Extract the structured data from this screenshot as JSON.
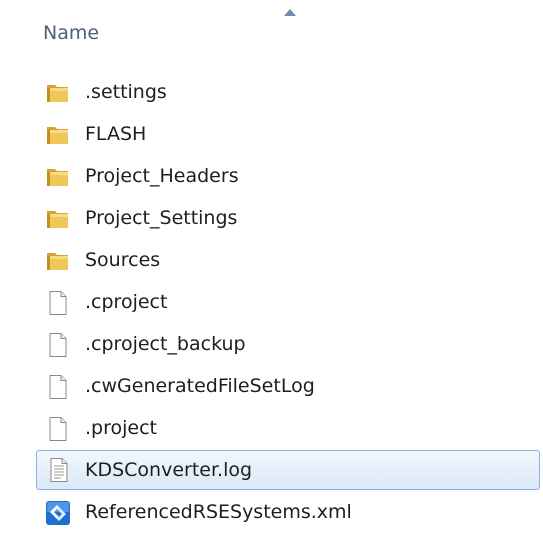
{
  "header": {
    "name_label": "Name"
  },
  "items": [
    {
      "name": ".settings",
      "type": "folder",
      "icon": "folder-icon"
    },
    {
      "name": "FLASH",
      "type": "folder",
      "icon": "folder-icon"
    },
    {
      "name": "Project_Headers",
      "type": "folder",
      "icon": "folder-icon"
    },
    {
      "name": "Project_Settings",
      "type": "folder",
      "icon": "folder-icon"
    },
    {
      "name": "Sources",
      "type": "folder",
      "icon": "folder-icon"
    },
    {
      "name": ".cproject",
      "type": "file",
      "icon": "blank-file-icon"
    },
    {
      "name": ".cproject_backup",
      "type": "file",
      "icon": "blank-file-icon"
    },
    {
      "name": ".cwGeneratedFileSetLog",
      "type": "file",
      "icon": "blank-file-icon"
    },
    {
      "name": ".project",
      "type": "file",
      "icon": "blank-file-icon"
    },
    {
      "name": "KDSConverter.log",
      "type": "file",
      "icon": "text-file-icon",
      "selected": true
    },
    {
      "name": "ReferencedRSESystems.xml",
      "type": "file",
      "icon": "xml-file-icon"
    }
  ],
  "colors": {
    "header_text": "#4c607a",
    "selection_border": "#8fb1dd",
    "selection_fill": "#dbe8f8",
    "folder": "#e8b84a"
  }
}
